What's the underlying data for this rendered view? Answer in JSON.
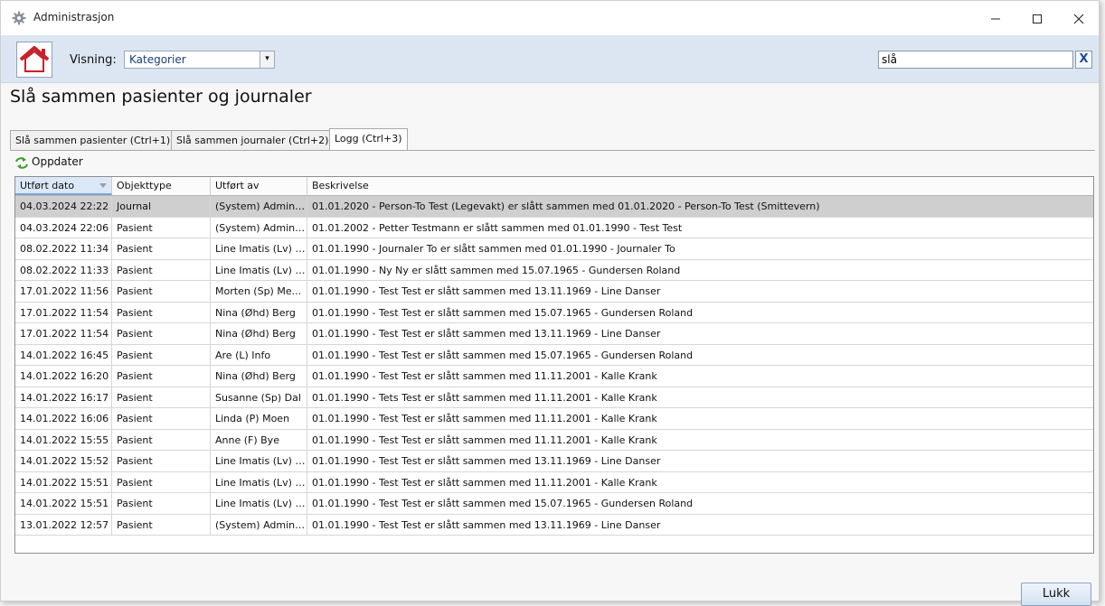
{
  "window": {
    "title": "Administrasjon"
  },
  "toolbar": {
    "view_label": "Visning:",
    "view_value": "Kategorier",
    "search_value": "slå",
    "search_clear_label": "X"
  },
  "page_title": "Slå sammen pasienter og journaler",
  "tabs": [
    {
      "label": "Slå sammen pasienter (Ctrl+1)"
    },
    {
      "label": "Slå sammen journaler (Ctrl+2)"
    },
    {
      "label": "Logg (Ctrl+3)"
    }
  ],
  "refresh_label": "Oppdater",
  "grid": {
    "columns": [
      "Utført dato",
      "Objekttype",
      "Utført av",
      "Beskrivelse"
    ],
    "rows": [
      [
        "04.03.2024 22:22",
        "Journal",
        "(System) Admini...",
        "01.01.2020 - Person-To Test (Legevakt) er slått sammen med 01.01.2020 - Person-To Test (Smittevern)"
      ],
      [
        "04.03.2024 22:06",
        "Pasient",
        "(System) Admini...",
        "01.01.2002 - Petter Testmann er slått sammen med 01.01.1990 - Test Test"
      ],
      [
        "08.02.2022 11:34",
        "Pasient",
        "Line Imatis (Lv) B...",
        "01.01.1990 - Journaler To er slått sammen med 01.01.1990 - Journaler To"
      ],
      [
        "08.02.2022 11:33",
        "Pasient",
        "Line Imatis (Lv) B...",
        "01.01.1990 - Ny Ny er slått sammen med 15.07.1965 - Gundersen Roland"
      ],
      [
        "17.01.2022 11:56",
        "Pasient",
        "Morten (Sp) Me...",
        "01.01.1990 - Test Test er slått sammen med 13.11.1969 - Line Danser"
      ],
      [
        "17.01.2022 11:54",
        "Pasient",
        "Nina (Øhd) Berg",
        "01.01.1990 - Test Test er slått sammen med 15.07.1965 - Gundersen Roland"
      ],
      [
        "17.01.2022 11:54",
        "Pasient",
        "Nina (Øhd) Berg",
        "01.01.1990 - Test Test er slått sammen med 13.11.1969 - Line Danser"
      ],
      [
        "14.01.2022 16:45",
        "Pasient",
        "Are (L) Info",
        "01.01.1990 - Test Test er slått sammen med 15.07.1965 - Gundersen Roland"
      ],
      [
        "14.01.2022 16:20",
        "Pasient",
        "Nina (Øhd) Berg",
        "01.01.1990 - Test Test er slått sammen med 11.11.2001 - Kalle Krank"
      ],
      [
        "14.01.2022 16:17",
        "Pasient",
        "Susanne (Sp) Dal",
        "01.01.1990 - Tets Test er slått sammen med 11.11.2001 - Kalle Krank"
      ],
      [
        "14.01.2022 16:06",
        "Pasient",
        "Linda (P) Moen",
        "01.01.1990 - Test Test er slått sammen med 11.11.2001 - Kalle Krank"
      ],
      [
        "14.01.2022 15:55",
        "Pasient",
        "Anne (F) Bye",
        "01.01.1990 - Test Test er slått sammen med 11.11.2001 - Kalle Krank"
      ],
      [
        "14.01.2022 15:52",
        "Pasient",
        "Line Imatis (Lv) B...",
        "01.01.1990 - Test Test er slått sammen med 13.11.1969 - Line Danser"
      ],
      [
        "14.01.2022 15:51",
        "Pasient",
        "Line Imatis (Lv) B...",
        "01.01.1990 - Test Test er slått sammen med 11.11.2001 - Kalle Krank"
      ],
      [
        "14.01.2022 15:51",
        "Pasient",
        "Line Imatis (Lv) B...",
        "01.01.1990 - Test Test er slått sammen med 15.07.1965 - Gundersen Roland"
      ],
      [
        "13.01.2022 12:57",
        "Pasient",
        "(System) Admini...",
        "01.01.1990 - Test Test er slått sammen med 13.11.1969 - Line Danser"
      ]
    ]
  },
  "close_button_label": "Lukk"
}
